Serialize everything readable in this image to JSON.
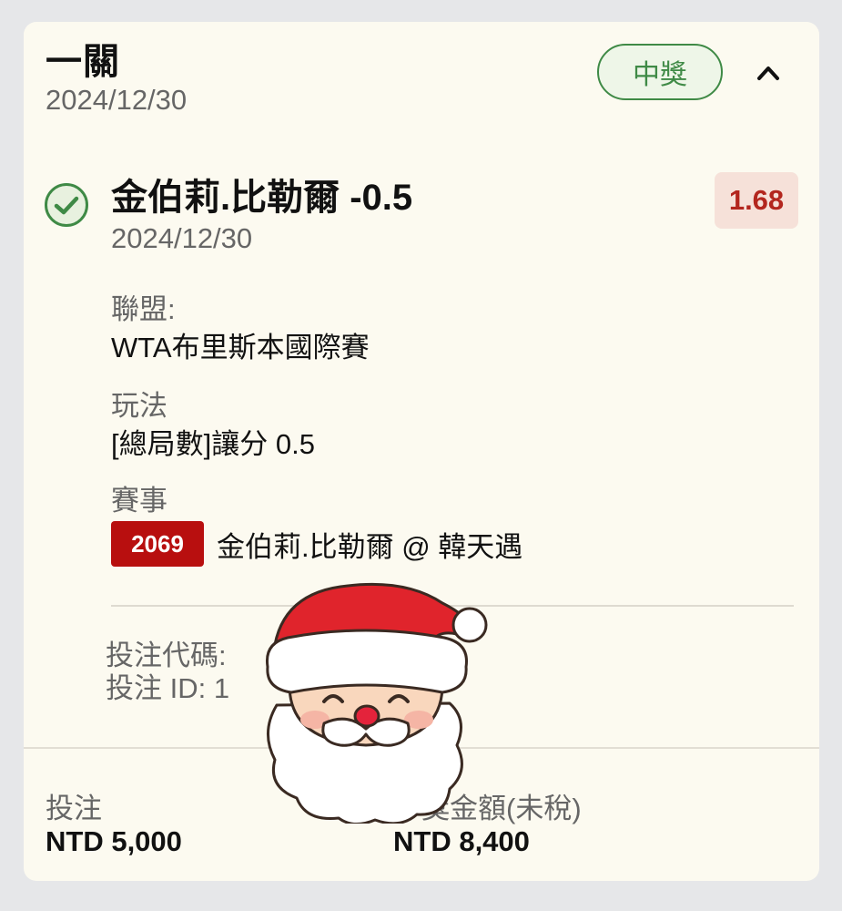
{
  "header": {
    "bet_type": "一關",
    "date": "2024/12/30",
    "status": "中獎"
  },
  "selection": {
    "title": "金伯莉.比勒爾 -0.5",
    "date": "2024/12/30",
    "odds": "1.68"
  },
  "league": {
    "label": "聯盟:",
    "value": "WTA布里斯本國際賽"
  },
  "market": {
    "label": "玩法",
    "value": "[總局數]讓分 0.5"
  },
  "event": {
    "label": "賽事",
    "code": "2069",
    "name": "金伯莉.比勒爾 @ 韓天遇"
  },
  "bet_code_line": "投注代碼:",
  "bet_id_line": "投注 ID: 1",
  "footer": {
    "stake_label": "投注",
    "stake_value": "NTD 5,000",
    "payout_label": "中獎金額(未稅)",
    "payout_value": "NTD 8,400"
  },
  "icons": {
    "check": "check-circle-icon",
    "collapse": "chevron-up-icon",
    "sticker": "santa-sticker"
  },
  "colors": {
    "win_green": "#3f8a46",
    "odds_red": "#b3261e",
    "event_code_bg": "#b80f0f",
    "card_bg": "#fcfaf0"
  }
}
